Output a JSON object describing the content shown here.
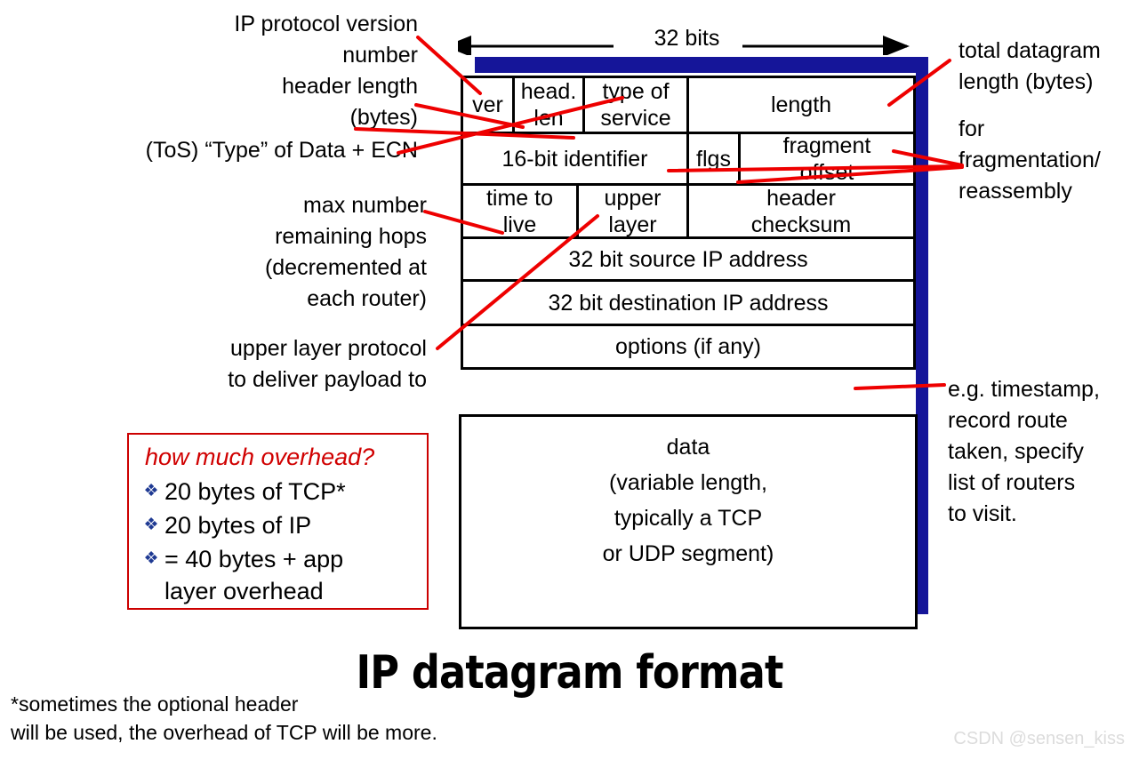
{
  "title": "IP datagram format",
  "ruler": {
    "label": "32 bits"
  },
  "datagram": {
    "rows": [
      {
        "name": "row-1",
        "cells": [
          {
            "name": "field-version",
            "text": "ver"
          },
          {
            "name": "field-header-length",
            "text": "head.\nlen"
          },
          {
            "name": "field-type-of-service",
            "text": "type of\nservice"
          },
          {
            "name": "field-length",
            "text": "length"
          }
        ]
      },
      {
        "name": "row-2",
        "cells": [
          {
            "name": "field-identifier",
            "text": "16-bit identifier"
          },
          {
            "name": "field-flags",
            "text": "flgs"
          },
          {
            "name": "field-fragment-offset",
            "text": "fragment\noffset"
          }
        ]
      },
      {
        "name": "row-3",
        "cells": [
          {
            "name": "field-time-to-live",
            "text": "time to\nlive"
          },
          {
            "name": "field-upper-layer",
            "text": "upper\nlayer"
          },
          {
            "name": "field-header-checksum",
            "text": "header\nchecksum"
          }
        ]
      },
      {
        "name": "row-4",
        "cells": [
          {
            "name": "field-source-ip",
            "text": "32 bit source IP address"
          }
        ]
      },
      {
        "name": "row-5",
        "cells": [
          {
            "name": "field-destination-ip",
            "text": "32 bit destination IP address"
          }
        ]
      },
      {
        "name": "row-6",
        "cells": [
          {
            "name": "field-options",
            "text": "options (if any)"
          }
        ]
      }
    ],
    "data_field": "data\n(variable length,\ntypically a TCP\nor UDP segment)"
  },
  "annotations_left": [
    {
      "name": "annotation-ip-version",
      "text": "IP protocol version\nnumber"
    },
    {
      "name": "annotation-header-length",
      "text": "header length\n(bytes)"
    },
    {
      "name": "annotation-type-of-service",
      "text": "(ToS) “Type” of Data + ECN"
    },
    {
      "name": "annotation-ttl",
      "text": "max number\nremaining hops\n(decremented at\neach router)"
    },
    {
      "name": "annotation-upper-layer",
      "text": "upper layer protocol\nto deliver payload to"
    }
  ],
  "annotations_right": [
    {
      "name": "annotation-total-length",
      "text": "total datagram\nlength (bytes)"
    },
    {
      "name": "annotation-fragmentation",
      "text": "for\nfragmentation/\nreassembly"
    },
    {
      "name": "annotation-options",
      "text": "e.g. timestamp,\nrecord route\ntaken, specify\nlist of routers\nto visit."
    }
  ],
  "overhead": {
    "title": "how much overhead?",
    "bullet_glyph": "❖",
    "items": [
      "20 bytes of TCP*",
      "20 bytes of IP",
      "= 40 bytes + app\nlayer overhead"
    ]
  },
  "footnote": "*sometimes the optional header\nwill be used, the overhead of TCP will be more.",
  "watermark": "CSDN @sensen_kiss",
  "colors": {
    "shadow_blue": "#151599",
    "leader_red": "#ee0000",
    "overhead_border": "#cc0000",
    "overhead_title": "#d00000",
    "bullet_navy": "#1f3a93",
    "watermark_gray": "#dcdcdc"
  }
}
